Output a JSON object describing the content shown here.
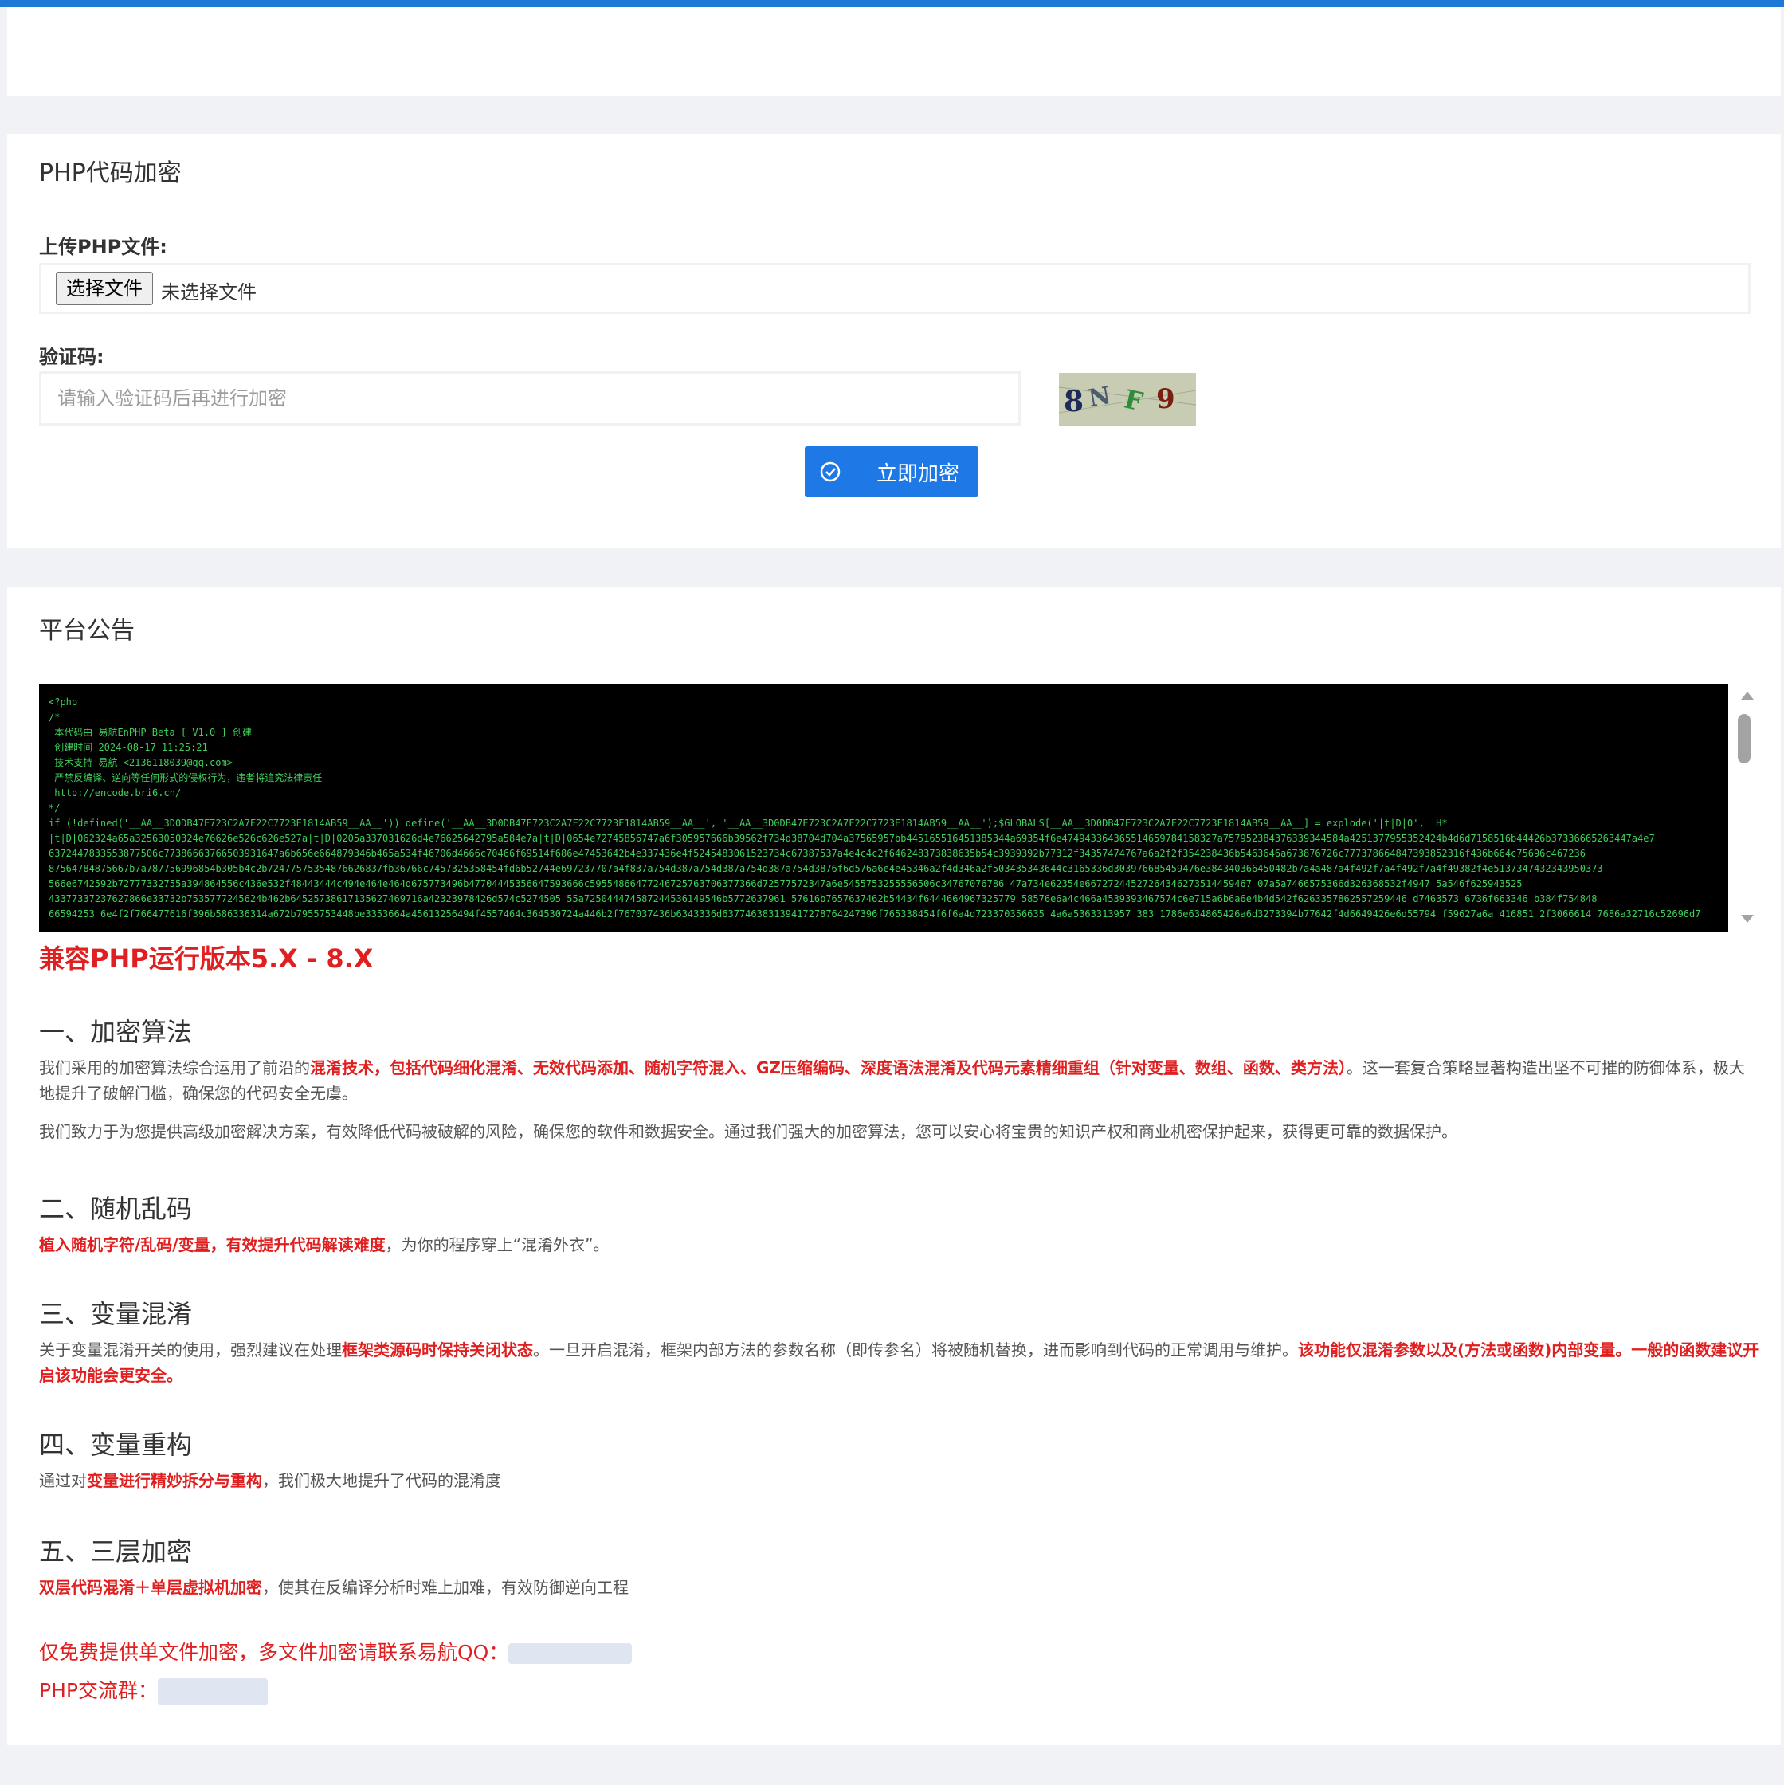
{
  "top": {},
  "form": {
    "title": "PHP代码加密",
    "upload_label": "上传PHP文件:",
    "file_button": "选择文件",
    "file_status": "未选择文件",
    "captcha_label": "验证码:",
    "captcha_placeholder": "请输入验证码后再进行加密",
    "captcha_text": "8NF9",
    "submit_label": "立即加密"
  },
  "notice": {
    "title": "平台公告",
    "code_lines": [
      "<?php",
      "/*",
      " 本代码由 易航EnPHP Beta [ V1.0 ] 创建",
      " 创建时间 2024-08-17 11:25:21",
      " 技术支持 易航 <2136118039@qq.com>",
      " 严禁反编译、逆向等任何形式的侵权行为，违者将追究法律责任",
      " http://encode.bri6.cn/",
      "*/",
      "if (!defined('__AA__3D0DB47E723C2A7F22C7723E1814AB59__AA__')) define('__AA__3D0DB47E723C2A7F22C7723E1814AB59__AA__', '__AA__3D0DB47E723C2A7F22C7723E1814AB59__AA__');$GLOBALS[__AA__3D0DB47E723C2A7F22C7723E1814AB59__AA__] = explode('|t|D|0', 'H*",
      "|t|D|062324a65a32563050324e76626e526c626e527a|t|D|0205a337031626d4e76625642795a584e7a|t|D|0654e72745856747a6f305957666b39562f734d38704d704a37565957bb445165516451385344a69354f6e474943364365514659784158327a757952384376339344584a4251377955352424b4d6d7158516b44426b37336665263447a4e7",
      "6372447833553877506c77386663766503931647a6b656e664879346b465a534f46706d4666c70466f69514f686e47453642b4e337436e4f5245483061523734c67387537a4e4c4c2f646248373838635b54c3939392b77312f34357474767a6a2f2f354238436b5463646a673876726c777378664847393852316f436b664c75696c467236",
      "87564784875667b7a787756996854b305b4c2b72477575354876626837fb36766c7457325358454fd6b52744e697237707a4f837a754d387a754d387a754d387a754d3876f6d576a6e4e45346a2f4d346a2f503435343644c3165336d303976685459476e384340366450482b7a4a487a4f492f7a4f492f7a4f49382f4e5137347432343950373",
      "566e6742592b72777332755a394864556c436e532f48443444c494e464e464d675773496b47704445356647593666c59554866477246725763706377366d72577572347a6e5455753255556506c34767076786 47a734e62354e66727244527264346273514459467 07a5a7466575366d326368532f4947 5a546f625943525",
      "43377337237627866e33732b7535777245624b462b64525738617135627469716a42323978426d574c5274505 55a725044474587244536149546b5772637961 57616b7657637462b54434f6444664967325779 58576e6a4c466a4539393467574c6e715a6b6a6e4b4d542f6263357862557259446 d7463573 6736f663346 b384f754848",
      "66594253 6e4f2f766477616f396b586336314a672b7955753448be3353664a45613256494f4557464c364530724a446b2f767037436b6343336d637746383139417278764247396f765338454f6f6a4d723370356635 4a6a5363313957 383 1786e634865426a6d3273394b77642f4d6649426e6d55794 f59627a6a 416851 2f3066614 7686a32716c52696d7"
    ],
    "compat": "兼容PHP运行版本5.X - 8.X",
    "s1_title": "一、加密算法",
    "s1_a": "我们采用的加密算法综合运用了前沿的",
    "s1_red": "混淆技术，包括代码细化混淆、无效代码添加、随机字符混入、GZ压缩编码、深度语法混淆及代码元素精细重组（针对变量、数组、函数、类方法）",
    "s1_b": "。这一套复合策略显著构造出坚不可摧的防御体系，极大地提升了破解门槛，确保您的代码安全无虞。",
    "s1_p2": "我们致力于为您提供高级加密解决方案，有效降低代码被破解的风险，确保您的软件和数据安全。通过我们强大的加密算法，您可以安心将宝贵的知识产权和商业机密保护起来，获得更可靠的数据保护。",
    "s2_title": "二、随机乱码",
    "s2_red": "植入随机字符/乱码/变量，有效提升代码解读难度",
    "s2_b": "，为你的程序穿上“混淆外衣”。",
    "s3_title": "三、变量混淆",
    "s3_a": "关于变量混淆开关的使用，强烈建议在处理",
    "s3_red1": "框架类源码时保持关闭状态",
    "s3_b": "。一旦开启混淆，框架内部方法的参数名称（即传参名）将被随机替换，进而影响到代码的正常调用与维护。",
    "s3_red2": "该功能仅混淆参数以及(方法或函数)内部变量。一般的函数建议开启该功能会更安全。",
    "s4_title": "四、变量重构",
    "s4_a": "通过对",
    "s4_red": "变量进行精妙拆分与重构",
    "s4_b": "，我们极大地提升了代码的混淆度",
    "s5_title": "五、三层加密",
    "s5_red": "双层代码混淆＋单层虚拟机加密",
    "s5_b": "，使其在反编译分析时难上加难，有效防御逆向工程",
    "qq_line": "仅免费提供单文件加密，多文件加密请联系易航QQ：",
    "group_line": "PHP交流群："
  }
}
